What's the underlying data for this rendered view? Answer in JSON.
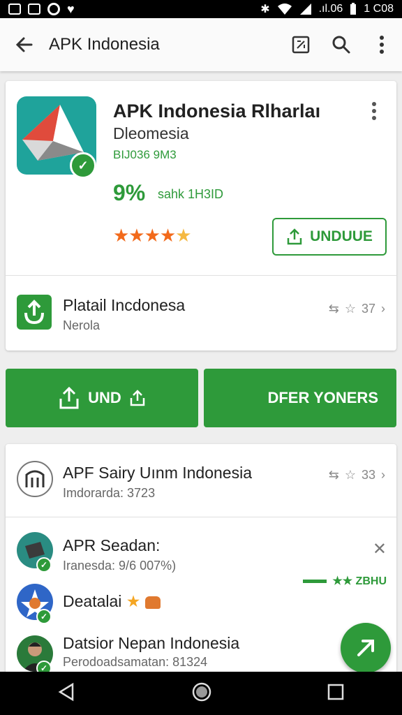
{
  "status_bar": {
    "time": "1 C08",
    "icons": [
      "gallery-icon",
      "image-icon",
      "sync-icon",
      "heart-icon",
      "bluetooth-icon",
      "wifi-icon",
      "signal-icon",
      "battery-icon"
    ],
    "data_label": ".ıl.06"
  },
  "toolbar": {
    "title": "APK Indonesia",
    "icons": [
      "back-arrow-icon",
      "screenshot-icon",
      "search-icon",
      "more-vert-icon"
    ]
  },
  "hero": {
    "app_name": "APK Indonesia Rlharlaı",
    "developer": "Dleomesia",
    "meta": "BIJ036 9M3",
    "percent": "9%",
    "percent_label": "sahk 1H3ID",
    "stars": "★★★★",
    "half_star": "★",
    "install_label": "UNDUUE",
    "row": {
      "title": "Platail Incdonesa",
      "subtitle": "Nerola",
      "count": "37"
    }
  },
  "actions": {
    "left_label": "UND",
    "right_label": "DFER YONERS"
  },
  "list": {
    "items": [
      {
        "title": "APF Sairy Uınm Indonesia",
        "subtitle": "Imdorarda: 3723",
        "count": "33"
      },
      {
        "title": "APR Seadan:",
        "subtitle": "Iranesda: 9/6 007%)",
        "tag": "★★ ZBHU"
      },
      {
        "title": "Deatalai",
        "emoji_star": "★"
      },
      {
        "title": "Datsior Nepan Indonesia",
        "subtitle": "Perodoadsamatan: 81324"
      }
    ]
  },
  "colors": {
    "primary_green": "#2e9a3a",
    "star_orange": "#f26a1b",
    "icon_teal": "#1fa39b"
  }
}
